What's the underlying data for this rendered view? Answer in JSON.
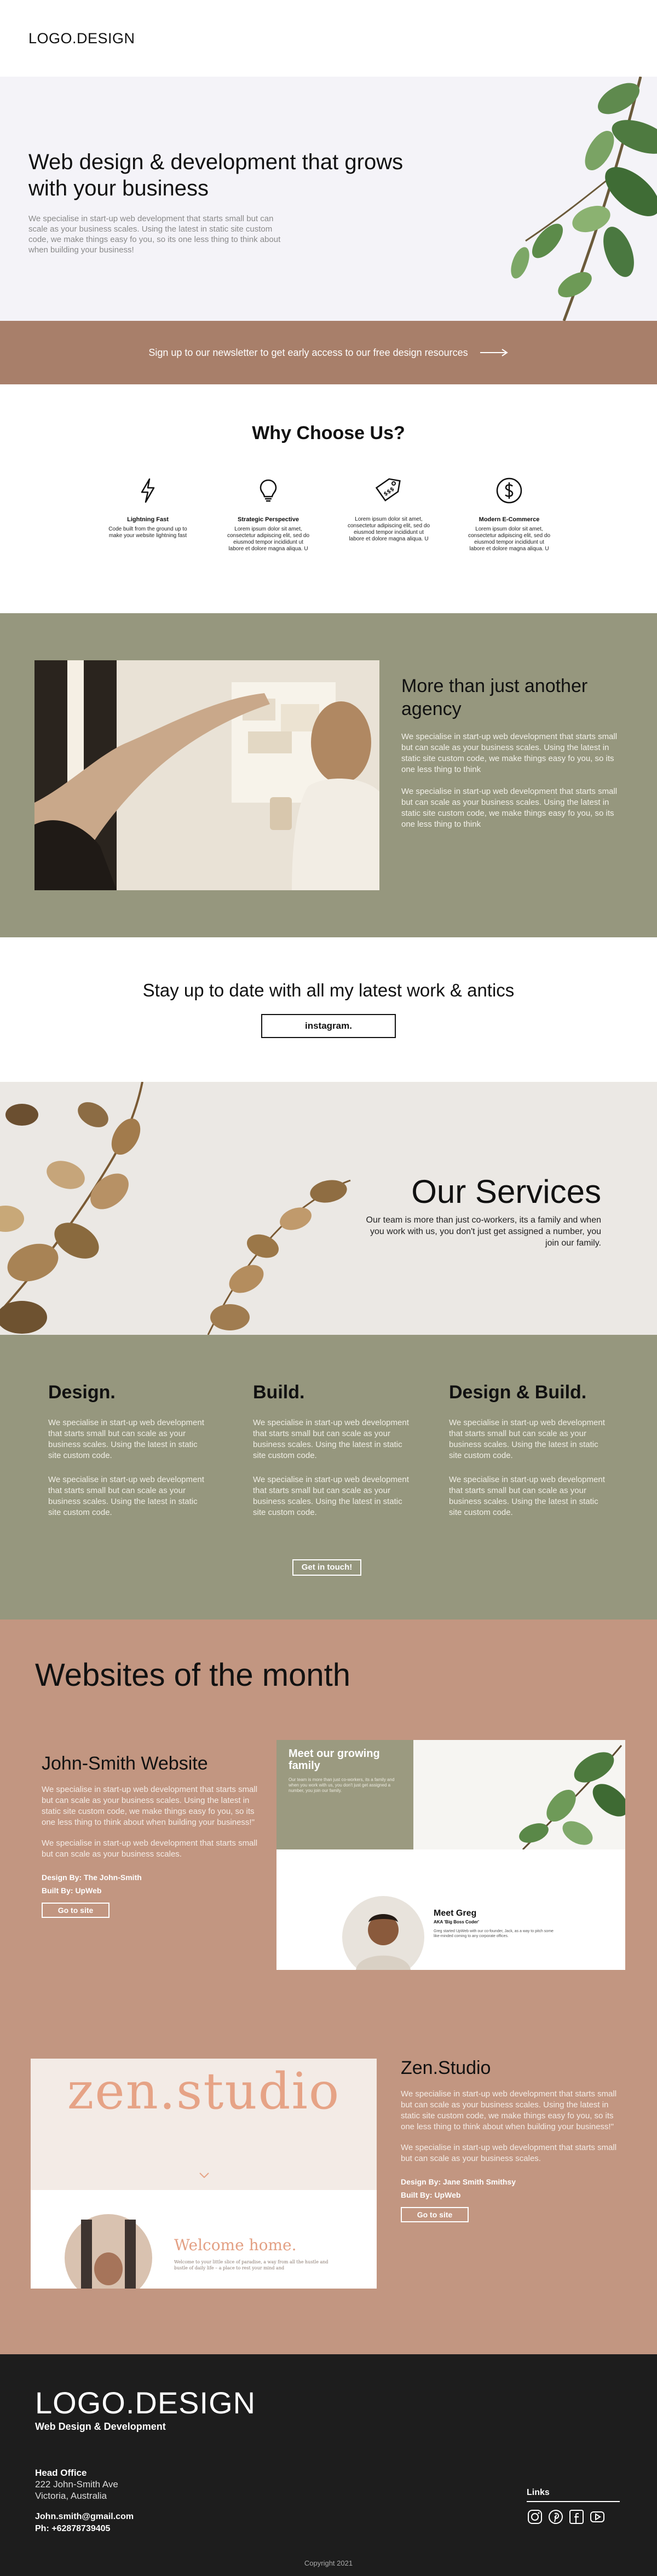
{
  "header": {
    "logo": "LOGO.DESIGN"
  },
  "hero": {
    "title": "Web design & development that grows with your business",
    "description": "We specialise in start-up web development that starts small but can scale as your business scales. Using the latest in static site custom code, we make things easy fo you, so its one less thing to think about when building your business!"
  },
  "newsletter": {
    "text": "Sign up to our newsletter to get early access to our free design resources",
    "icon": "arrow-right-icon"
  },
  "why": {
    "title": "Why Choose Us?",
    "features": [
      {
        "icon": "lightning-icon",
        "title": "Lightning Fast",
        "desc": "Code built from the ground up to make your website lightning fast"
      },
      {
        "icon": "lightbulb-icon",
        "title": "Strategic Perspective",
        "desc": "Lorem ipsum dolor sit amet, consectetur adipiscing elit, sed do eiusmod tempor incididunt ut labore et dolore magna aliqua. U"
      },
      {
        "icon": "price-tag-icon",
        "title": "",
        "desc": "Lorem ipsum dolor sit amet, consectetur adipiscing elit, sed do eiusmod tempor incididunt ut labore et dolore magna aliqua. U"
      },
      {
        "icon": "dollar-icon",
        "title": "Modern E-Commerce",
        "desc": "Lorem ipsum dolor sit amet, consectetur adipiscing elit, sed do eiusmod tempor incididunt ut labore et dolore magna aliqua. U"
      }
    ]
  },
  "agency": {
    "title": "More than just another agency",
    "p1": "We specialise in start-up web development that starts small but can scale as your business scales. Using the latest in static site custom code, we make things easy fo you, so its one less thing to think",
    "p2": "We specialise in start-up web development that starts small but can scale as your business scales. Using the latest in static site custom code, we make things easy fo you, so its one less thing to think"
  },
  "stay": {
    "title": "Stay up to date with all my latest work & antics",
    "button": "instagram."
  },
  "services_hero": {
    "title": "Our Services",
    "description": "Our team is more than just co-workers, its a family and when you work with us, you don't just get assigned a number, you join our family."
  },
  "services": {
    "columns": [
      {
        "title": "Design.",
        "p1": "We specialise in start-up web development that starts small but can scale as your business scales. Using the latest in static site custom code.",
        "p2": "We specialise in start-up web development that starts small but can scale as your business scales. Using the latest in static site custom code."
      },
      {
        "title": "Build.",
        "p1": "We specialise in start-up web development that starts small but can scale as your business scales. Using the latest in static site custom code.",
        "p2": "We specialise in start-up web development that starts small but can scale as your business scales. Using the latest in static site custom code."
      },
      {
        "title": "Design & Build.",
        "p1": "We specialise in start-up web development that starts small but can scale as your business scales. Using the latest in static site custom code.",
        "p2": "We specialise in start-up web development that starts small but can scale as your business scales. Using the latest in static site custom code."
      }
    ],
    "button": "Get in touch!"
  },
  "wotm": {
    "title": "Websites of the month",
    "case1": {
      "title": "John-Smith Website",
      "p1": "We specialise in start-up web development that starts small but can scale as your business scales. Using the latest in static site custom code, we make things easy fo you, so its one less thing to think about when building your business!\"",
      "p2": "We specialise in start-up web development that starts small but can scale as your business scales.",
      "design_by": "Design By: The John-Smith",
      "built_by": "Built By: UpWeb",
      "button": "Go to site",
      "mock": {
        "heading": "Meet our growing family",
        "body": "Our team is more than just co-workers, its a family and when you work with us, you don't just get assigned a number, you join our family.",
        "person_name": "Meet Greg",
        "person_role": "AKA 'Big Boss Coder'",
        "person_desc": "Greg started UpWeb with our co-founder, Jack, as a way to pitch some like-minded coming to any corporate offices."
      }
    },
    "case2": {
      "title": "Zen.Studio",
      "p1": "We specialise in start-up web development that starts small but can scale as your business scales. Using the latest in static site custom code, we make things easy fo you, so its one less thing to think about when building your business!\"",
      "p2": "We specialise in start-up web development that starts small but can scale as your business scales.",
      "design_by": "Design By: Jane Smith Smithsy",
      "built_by": "Built By: UpWeb",
      "button": "Go to site",
      "mock": {
        "brand": "zen.studio",
        "welcome": "Welcome home.",
        "body": "Welcome to your little slice of paradise, a way from all the hustle and bustle of daily life – a place to rest your mind and"
      }
    }
  },
  "footer": {
    "logo": "LOGO.DESIGN",
    "subtitle": "Web Design & Development",
    "office_title": "Head Office",
    "address1": "222 John-Smith Ave",
    "address2": "Victoria, Australia",
    "email": "John.smith@gmail.com",
    "phone": "Ph: +62878739405",
    "links_title": "Links",
    "socials": [
      "instagram-icon",
      "pinterest-icon",
      "facebook-icon",
      "youtube-icon"
    ],
    "copyright": "Copyright 2021"
  },
  "colors": {
    "newsletter_bg": "#a87f6a",
    "olive": "#96977e",
    "terracotta": "#c29681",
    "footer_bg": "#1d1d1d"
  }
}
